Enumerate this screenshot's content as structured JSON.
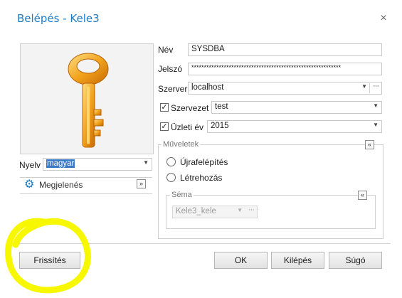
{
  "window": {
    "title": "Belépés - Kele3",
    "close_glyph": "×"
  },
  "image": {
    "icon": "key-icon"
  },
  "form": {
    "name_label": "Név",
    "name_value": "SYSDBA",
    "password_label": "Jelszó",
    "password_value": "************************************************************",
    "server_label": "Szerver",
    "server_value": "localhost",
    "org_label": "Szervezet",
    "org_value": "test",
    "org_checked": true,
    "year_label": "Üzleti év",
    "year_value": "2015",
    "year_checked": true
  },
  "language": {
    "label": "Nyelv",
    "value": "magyar"
  },
  "appearance": {
    "label": "Megjelenés",
    "icon": "gear-icon"
  },
  "operations": {
    "label": "Műveletek",
    "options": [
      {
        "label": "Újrafelépítés"
      },
      {
        "label": "Létrehozás"
      }
    ],
    "schema": {
      "label": "Séma",
      "value": "Kele3_kele"
    }
  },
  "buttons": {
    "refresh": "Frissítés",
    "ok": "OK",
    "exit": "Kilépés",
    "help": "Súgó"
  },
  "colors": {
    "title": "#1f7cc3",
    "selection": "#3b79c7",
    "annotation": "#f7f700"
  }
}
